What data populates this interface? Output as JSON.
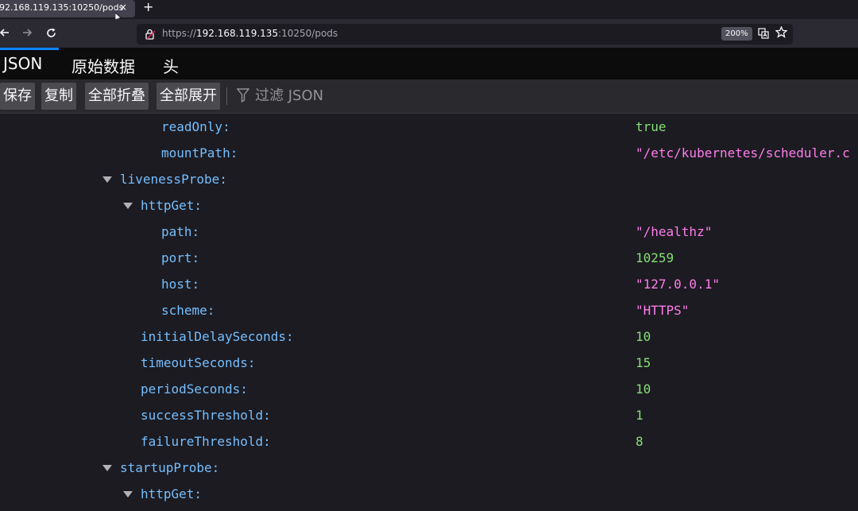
{
  "browser": {
    "tab_title": "92.168.119.135:10250/pods",
    "tab_close": "×",
    "new_tab": "+",
    "url_prefix": "https://",
    "url_host": "192.168.119.135",
    "url_rest": ":10250/pods",
    "zoom": "200%"
  },
  "viewer_tabs": [
    "JSON",
    "原始数据",
    "头"
  ],
  "active_tab": "JSON",
  "toolbar": {
    "save": "保存",
    "copy": "复制",
    "collapse_all": "全部折叠",
    "expand_all": "全部展开",
    "filter_placeholder": "过滤 JSON"
  },
  "tree": [
    {
      "key": "readOnly:",
      "value": "true",
      "type": "bool",
      "depth": 3
    },
    {
      "key": "mountPath:",
      "value": "\"/etc/kubernetes/scheduler.c",
      "type": "str",
      "depth": 3
    },
    {
      "key": "livenessProbe:",
      "value": "",
      "type": "obj",
      "depth": 1
    },
    {
      "key": "httpGet:",
      "value": "",
      "type": "obj",
      "depth": 2
    },
    {
      "key": "path:",
      "value": "\"/healthz\"",
      "type": "str",
      "depth": 3
    },
    {
      "key": "port:",
      "value": "10259",
      "type": "num",
      "depth": 3
    },
    {
      "key": "host:",
      "value": "\"127.0.0.1\"",
      "type": "str",
      "depth": 3
    },
    {
      "key": "scheme:",
      "value": "\"HTTPS\"",
      "type": "str",
      "depth": 3
    },
    {
      "key": "initialDelaySeconds:",
      "value": "10",
      "type": "num",
      "depth": 2
    },
    {
      "key": "timeoutSeconds:",
      "value": "15",
      "type": "num",
      "depth": 2
    },
    {
      "key": "periodSeconds:",
      "value": "10",
      "type": "num",
      "depth": 2
    },
    {
      "key": "successThreshold:",
      "value": "1",
      "type": "num",
      "depth": 2
    },
    {
      "key": "failureThreshold:",
      "value": "8",
      "type": "num",
      "depth": 2
    },
    {
      "key": "startupProbe:",
      "value": "",
      "type": "obj",
      "depth": 1
    },
    {
      "key": "httpGet:",
      "value": "",
      "type": "obj",
      "depth": 2
    }
  ]
}
